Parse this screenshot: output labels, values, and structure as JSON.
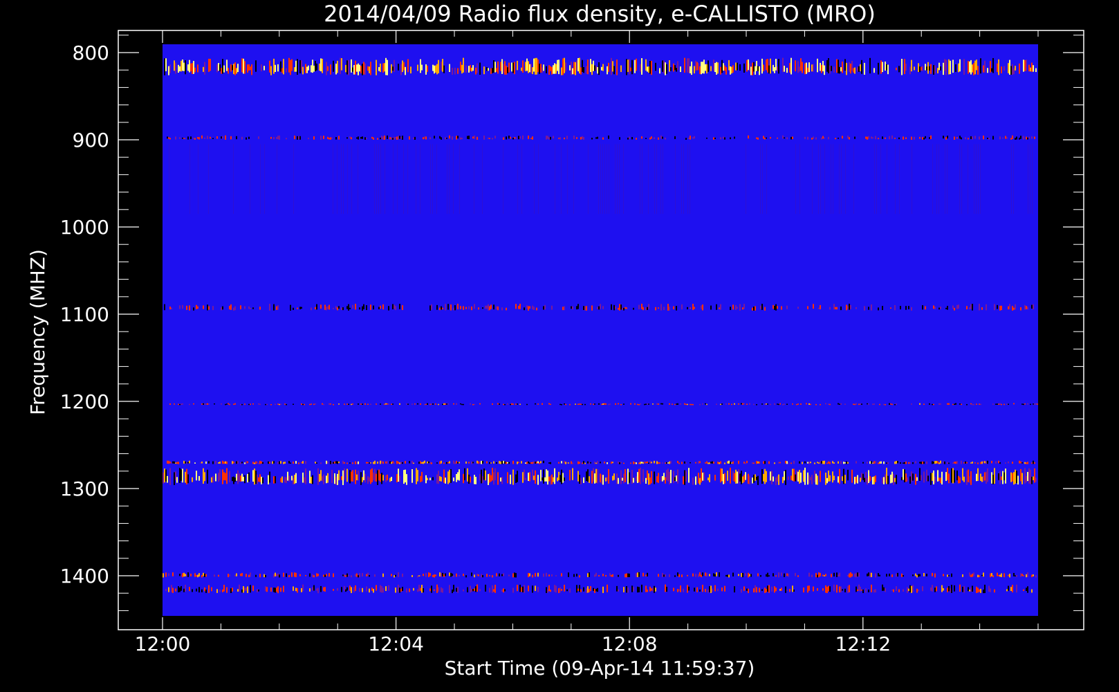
{
  "chart_data": {
    "type": "heatmap",
    "title": "2014/04/09  Radio flux density, e-CALLISTO (MRO)",
    "xlabel": "Start Time (09-Apr-14 11:59:37)",
    "ylabel": "Frequency (MHZ)",
    "x_ticks": [
      "12:00",
      "12:04",
      "12:08",
      "12:12"
    ],
    "x_tick_minutes": [
      0,
      4,
      8,
      12
    ],
    "x_range_minutes": [
      0,
      15
    ],
    "y_ticks": [
      800,
      900,
      1000,
      1100,
      1200,
      1300,
      1400
    ],
    "ylim": [
      1450,
      790
    ],
    "y_axis_inverted": true,
    "colormap": [
      "#000000",
      "#1a00ff",
      "#7a1a99",
      "#ff3000",
      "#ffaa00",
      "#ffff80"
    ],
    "background_color": "#1e10f0",
    "bands": [
      {
        "freq_start": 806,
        "freq_end": 826,
        "intensity": 0.85
      },
      {
        "freq_start": 895,
        "freq_end": 900,
        "intensity": 0.5
      },
      {
        "freq_start": 1088,
        "freq_end": 1096,
        "intensity": 0.5
      },
      {
        "freq_start": 1202,
        "freq_end": 1204,
        "intensity": 0.55
      },
      {
        "freq_start": 1268,
        "freq_end": 1272,
        "intensity": 0.7
      },
      {
        "freq_start": 1276,
        "freq_end": 1296,
        "intensity": 0.85
      },
      {
        "freq_start": 1396,
        "freq_end": 1402,
        "intensity": 0.6
      },
      {
        "freq_start": 1410,
        "freq_end": 1420,
        "intensity": 0.6
      }
    ]
  }
}
